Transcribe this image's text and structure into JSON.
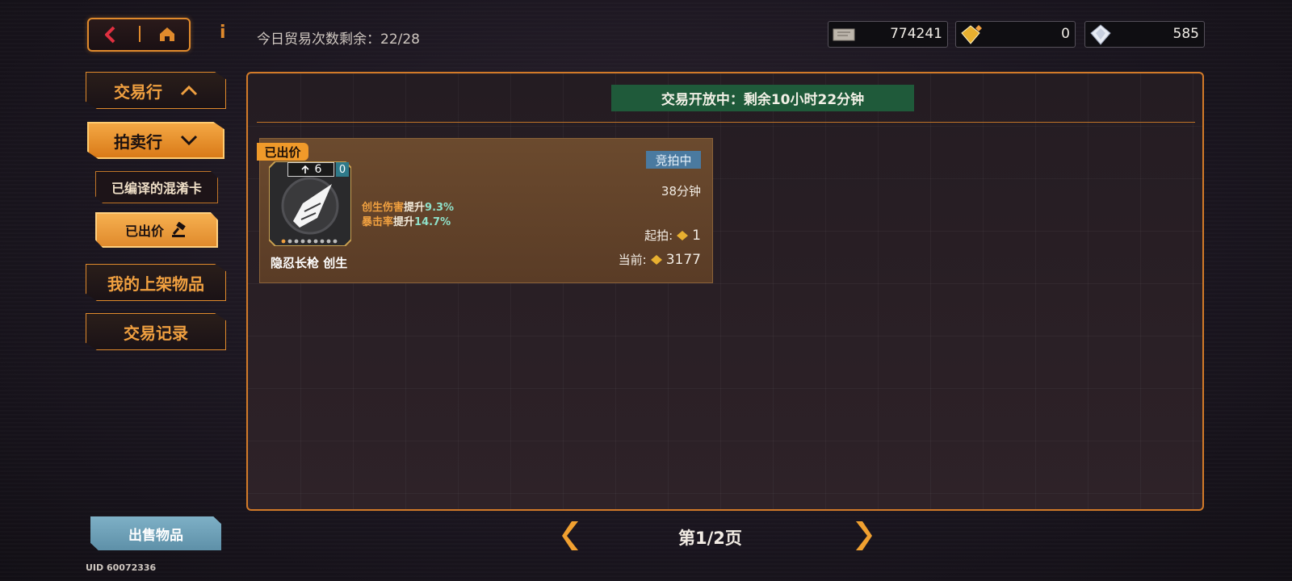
{
  "topbar": {
    "trade_remaining_label": "今日贸易次数剩余：22/28",
    "currencies": [
      {
        "icon": "ticket-icon",
        "value": "774241"
      },
      {
        "icon": "gold-gem-icon",
        "value": "0"
      },
      {
        "icon": "diamond-icon",
        "value": "585"
      }
    ]
  },
  "sidebar": {
    "trade_house": "交易行",
    "auction_house": "拍卖行",
    "sub_items": [
      "已编译的混淆卡",
      "已出价"
    ],
    "my_listings": "我的上架物品",
    "trade_records": "交易记录",
    "sell_button": "出售物品",
    "uid": "UID 60072336"
  },
  "main": {
    "timer_banner": "交易开放中：剩余10小时22分钟",
    "item": {
      "bid_tag": "已出价",
      "status": "竞拍中",
      "level": "6",
      "level_extra": "0",
      "stats": [
        {
          "name": "创生伤害",
          "mid": "提升",
          "value": "9.3%"
        },
        {
          "name": "暴击率",
          "mid": "提升",
          "value": "14.7%"
        }
      ],
      "name": "隐忍长枪 创生",
      "duration": "38分钟",
      "start_label": "起拍:",
      "start_value": "1",
      "current_label": "当前:",
      "current_value": "3177"
    }
  },
  "pager": {
    "label": "第1/2页"
  },
  "colors": {
    "accent": "#e08a2c",
    "banner": "#1f5a3a",
    "status": "#4a7aa0"
  }
}
